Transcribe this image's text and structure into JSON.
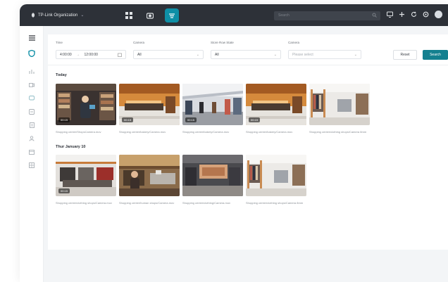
{
  "topbar": {
    "org_name": "TP-Link Organization",
    "search_placeholder": "Search"
  },
  "filters": {
    "time_label": "Time",
    "time_start": "4:00:00",
    "time_end": "12:00:00",
    "camera_label": "Camera",
    "camera_value": "All",
    "store_label": "Store Row State",
    "store_value": "All",
    "camera2_label": "Camera",
    "camera2_placeholder": "Please select",
    "reset_label": "Reset",
    "search_label": "Search"
  },
  "sections": [
    {
      "title": "Today",
      "items": [
        {
          "caption": "Shopping center/ShopsCamera.mov",
          "badge": "00:15"
        },
        {
          "caption": "Shopping center/bakery/Camera.mov",
          "badge": "00:15"
        },
        {
          "caption": "Shopping center/bakery/Camera.mov",
          "badge": "00:15"
        },
        {
          "caption": "Shopping center/bakery/Camera.mov",
          "badge": "00:15"
        },
        {
          "caption": "Shopping center/clothing shops/Camera 8mm",
          "badge": ""
        }
      ]
    },
    {
      "title": "Thur January 10",
      "items": [
        {
          "caption": "Shopping center/clothing shops/Camera.mov",
          "badge": "00:15"
        },
        {
          "caption": "Shopping center/human shops/Camera.mov",
          "badge": ""
        },
        {
          "caption": "Shopping center/clothing/Camera.mov",
          "badge": ""
        },
        {
          "caption": "Shopping center/clothing shops/Camera 8mm",
          "badge": ""
        }
      ]
    }
  ],
  "colors": {
    "topbar": "#2d3138",
    "accent": "#0e8fa6",
    "search_button": "#14808f"
  }
}
